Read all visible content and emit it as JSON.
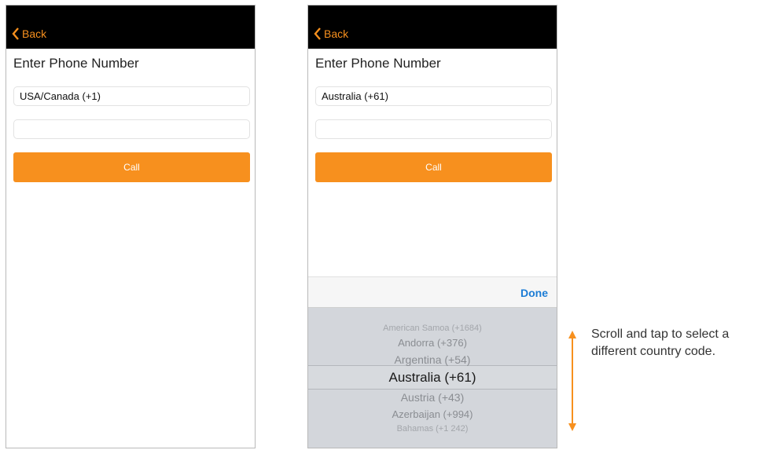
{
  "left_screen": {
    "back_label": "Back",
    "title": "Enter Phone Number",
    "country_value": "USA/Canada (+1)",
    "phone_value": "",
    "call_label": "Call"
  },
  "right_screen": {
    "back_label": "Back",
    "title": "Enter Phone Number",
    "country_value": "Australia (+61)",
    "phone_value": "",
    "call_label": "Call",
    "picker": {
      "done_label": "Done",
      "options": [
        "American Samoa (+1684)",
        "Andorra (+376)",
        "Argentina (+54)",
        "Australia (+61)",
        "Austria (+43)",
        "Azerbaijan (+994)",
        "Bahamas (+1 242)"
      ],
      "selected": "Australia (+61)"
    }
  },
  "annotation": {
    "caption_line1": "Scroll and tap to select a",
    "caption_line2": "different country code."
  },
  "colors": {
    "accent": "#f7901e",
    "done_blue": "#1c7cd5",
    "navbar": "#000000"
  },
  "icons": {
    "back": "chevron-left-icon",
    "arrow": "double-arrow-icon"
  }
}
